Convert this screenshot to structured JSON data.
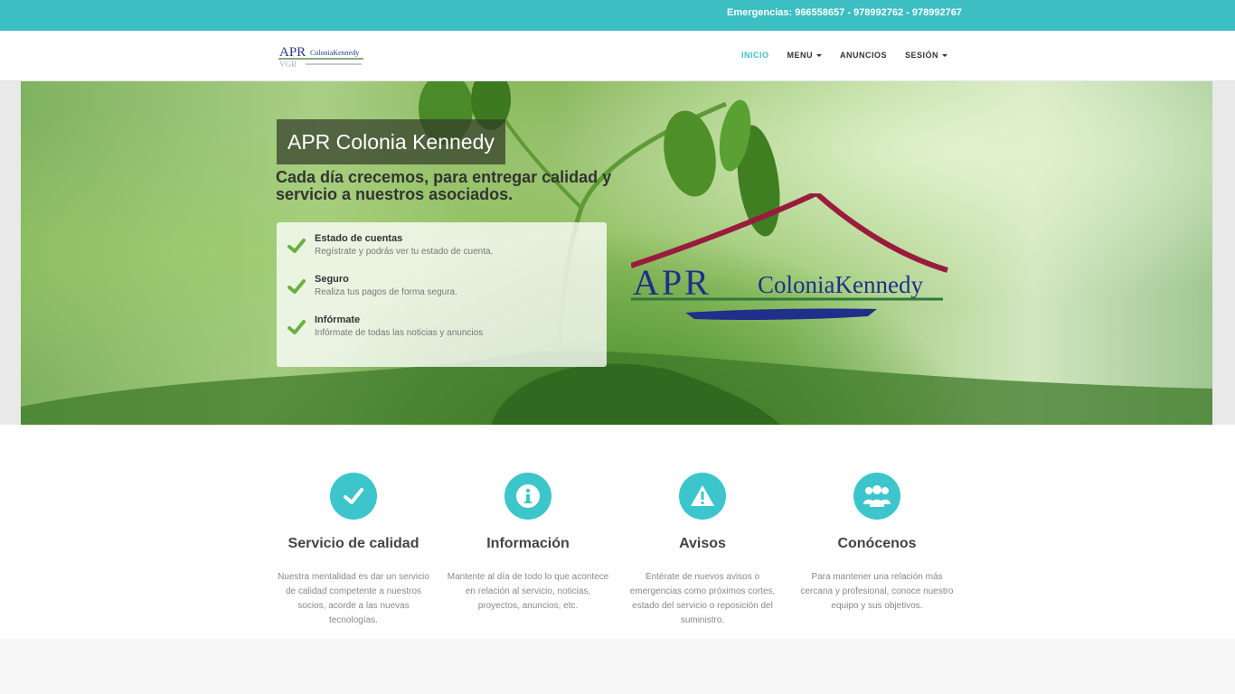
{
  "topbar": {
    "emergency": "Emergencias: 966558657 - 978992762 - 978992767"
  },
  "header": {
    "logo_text": "APR Colonia Kennedy",
    "nav": [
      {
        "label": "INICIO",
        "active": true,
        "dropdown": false
      },
      {
        "label": "MENU",
        "active": false,
        "dropdown": true
      },
      {
        "label": "ANUNCIOS",
        "active": false,
        "dropdown": false
      },
      {
        "label": "SESIÓN",
        "active": false,
        "dropdown": true
      }
    ]
  },
  "hero": {
    "title": "APR Colonia Kennedy",
    "subtitle": "Cada día crecemos, para entregar calidad y servicio a nuestros asociados.",
    "features": [
      {
        "title": "Estado de cuentas",
        "desc": "Regístrate y podrás ver tu estado de cuenta."
      },
      {
        "title": "Seguro",
        "desc": "Realiza tus pagos de forma segura."
      },
      {
        "title": "Infórmate",
        "desc": "Infórmate de todas las noticias y anuncios"
      }
    ],
    "logo_text": "APR Colonia Kennedy"
  },
  "services": [
    {
      "icon": "check-icon",
      "title": "Servicio de calidad",
      "desc": "Nuestra mentalidad es dar un servicio de calidad competente a nuestros socios, acorde a las nuevas tecnologías."
    },
    {
      "icon": "info-icon",
      "title": "Información",
      "desc": "Mantente al día de todo lo que acontece en relación al servicio, noticias, proyectos, anuncios, etc."
    },
    {
      "icon": "warning-icon",
      "title": "Avisos",
      "desc": "Entérate de nuevos avisos o emergencias como próximos cortes, estado del servicio o reposición del suministro."
    },
    {
      "icon": "users-icon",
      "title": "Conócenos",
      "desc": "Para mantener una relación más cercana y profesional, conoce nuestro equipo y sus objetivos."
    }
  ],
  "colors": {
    "accent": "#3dbec2",
    "icon_bg": "#3dc5cc",
    "check_green": "#6ab043",
    "logo_red": "#9a1b3c",
    "logo_blue": "#1f2f8a"
  }
}
